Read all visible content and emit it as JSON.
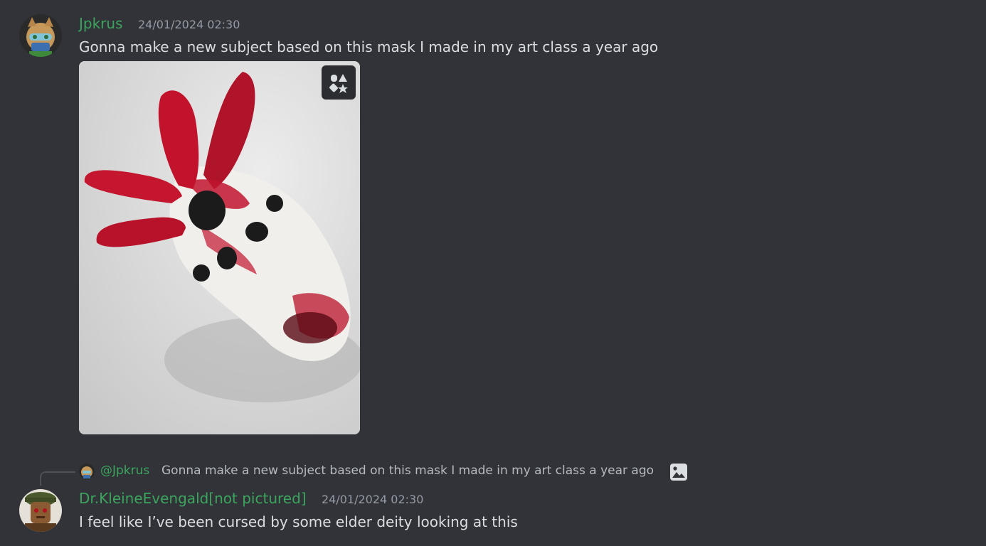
{
  "messages": [
    {
      "username": "Jpkrus",
      "timestamp": "24/01/2024 02:30",
      "content": "Gonna make a new subject based on this mask I made in my art class a year ago",
      "attachment": {
        "type": "image",
        "subject": "painted mask"
      }
    },
    {
      "username": "Dr.KleineEvengald[not pictured]",
      "timestamp": "24/01/2024 02:30",
      "content": "I feel like I’ve been cursed by some elder deity looking at this",
      "reply_to": {
        "mention": "@Jpkrus",
        "preview": "Gonna make a new subject based on this mask I made in my art class a year ago",
        "icon": "image-icon"
      }
    }
  ],
  "colors": {
    "background": "#313338",
    "username": "#3ba55d",
    "timestamp": "#949ba4",
    "text": "#dbdee1"
  },
  "icons": [
    "apps-icon",
    "image-icon"
  ]
}
